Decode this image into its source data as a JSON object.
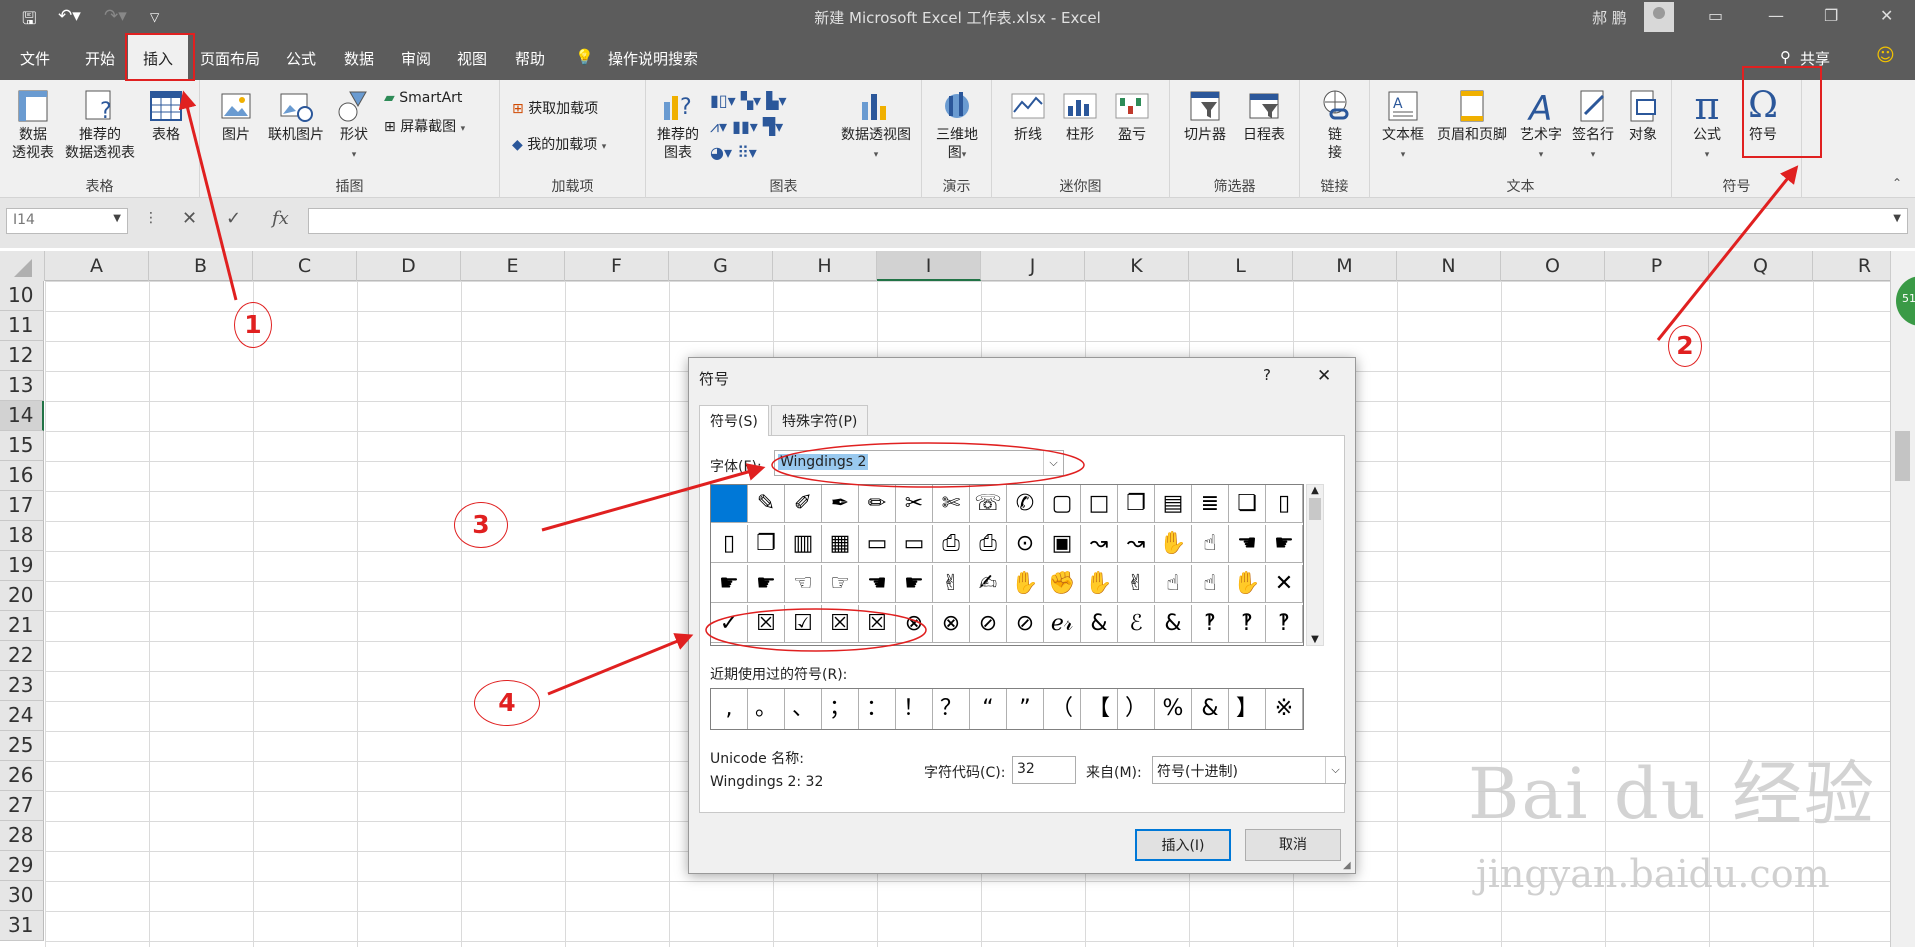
{
  "titlebar": {
    "title": "新建 Microsoft Excel 工作表.xlsx  -  Excel",
    "user": "郝 鹏"
  },
  "menu": {
    "tabs": [
      "文件",
      "开始",
      "插入",
      "页面布局",
      "公式",
      "数据",
      "审阅",
      "视图",
      "帮助"
    ],
    "tell_me": "操作说明搜索",
    "share": "共享"
  },
  "ribbon": {
    "tables": {
      "label": "表格",
      "pivot": "数据\n透视表",
      "recommended_pivot": "推荐的\n数据透视表",
      "table": "表格"
    },
    "illustrations": {
      "label": "插图",
      "picture": "图片",
      "online_picture": "联机图片",
      "shapes": "形状",
      "smartart": "SmartArt",
      "screenshot": "屏幕截图"
    },
    "addins": {
      "label": "加载项",
      "get": "获取加载项",
      "my": "我的加载项"
    },
    "charts": {
      "label": "图表",
      "recommended": "推荐的\n图表",
      "pivot_chart": "数据透视图"
    },
    "tours": {
      "label": "演示",
      "map3d": "三维地\n图"
    },
    "sparklines": {
      "label": "迷你图",
      "line": "折线",
      "column": "柱形",
      "winloss": "盈亏"
    },
    "filters": {
      "label": "筛选器",
      "slicer": "切片器",
      "timeline": "日程表"
    },
    "links": {
      "label": "链接",
      "link": "链\n接"
    },
    "text": {
      "label": "文本",
      "textbox": "文本框",
      "header_footer": "页眉和页脚",
      "wordart": "艺术字",
      "signature": "签名行",
      "object": "对象"
    },
    "symbols": {
      "label": "符号",
      "equation": "公式",
      "symbol": "符号"
    }
  },
  "formula_bar": {
    "name_box": "I14",
    "fx": "fx"
  },
  "sheet": {
    "columns": [
      "A",
      "B",
      "C",
      "D",
      "E",
      "F",
      "G",
      "H",
      "I",
      "J",
      "K",
      "L",
      "M",
      "N",
      "O",
      "P",
      "Q",
      "R"
    ],
    "rows": [
      "10",
      "11",
      "12",
      "13",
      "14",
      "15",
      "16",
      "17",
      "18",
      "19",
      "20",
      "21",
      "22",
      "23",
      "24",
      "25",
      "26",
      "27",
      "28",
      "29",
      "30",
      "31"
    ],
    "active_column": "I",
    "active_row": "14"
  },
  "dialog": {
    "title": "符号",
    "help": "?",
    "close": "✕",
    "tabs": [
      "符号(S)",
      "特殊字符(P)"
    ],
    "font_label": "字体(F):",
    "font_value": "Wingdings 2",
    "symbols": [
      [
        "",
        "✎",
        "✐",
        "✒",
        "✏",
        "✂",
        "✄",
        "☏",
        "✆",
        "▢",
        "□",
        "❐",
        "▤",
        "≣",
        "❏",
        "▯"
      ],
      [
        "▯",
        "❐",
        "▥",
        "▦",
        "▭",
        "▭",
        "⎙",
        "⎙",
        "⊙",
        "▣",
        "↝",
        "↝",
        "✋",
        "☝",
        "☚",
        "☛"
      ],
      [
        "☛",
        "☛",
        "☜",
        "☞",
        "☚",
        "☛",
        "✌",
        "✍",
        "✋",
        "✊",
        "✋",
        "✌",
        "☝",
        "☝",
        "✋",
        "✕"
      ],
      [
        "✓",
        "☒",
        "☑",
        "☒",
        "☒",
        "⊗",
        "⊗",
        "⊘",
        "⊘",
        "ℯ𝓇",
        "&",
        "ℰ",
        "&",
        "‽",
        "‽",
        "‽"
      ]
    ],
    "recent_label": "近期使用过的符号(R):",
    "recent": [
      ",",
      "。",
      "、",
      "；",
      "：",
      "！",
      "？",
      "“",
      "”",
      "（",
      "【",
      "）",
      "%",
      "&",
      "】",
      "※"
    ],
    "unicode_label": "Unicode 名称:",
    "unicode_value": "Wingdings 2: 32",
    "code_label": "字符代码(C):",
    "code_value": "32",
    "from_label": "来自(M):",
    "from_value": "符号(十进制)",
    "insert": "插入(I)",
    "cancel": "取消"
  },
  "annotations": {
    "n1": "1",
    "n2": "2",
    "n3": "3",
    "n4": "4",
    "color": "#e02020"
  },
  "watermark": {
    "brand": "Bai du 经验",
    "url": "jingyan.baidu.com"
  }
}
